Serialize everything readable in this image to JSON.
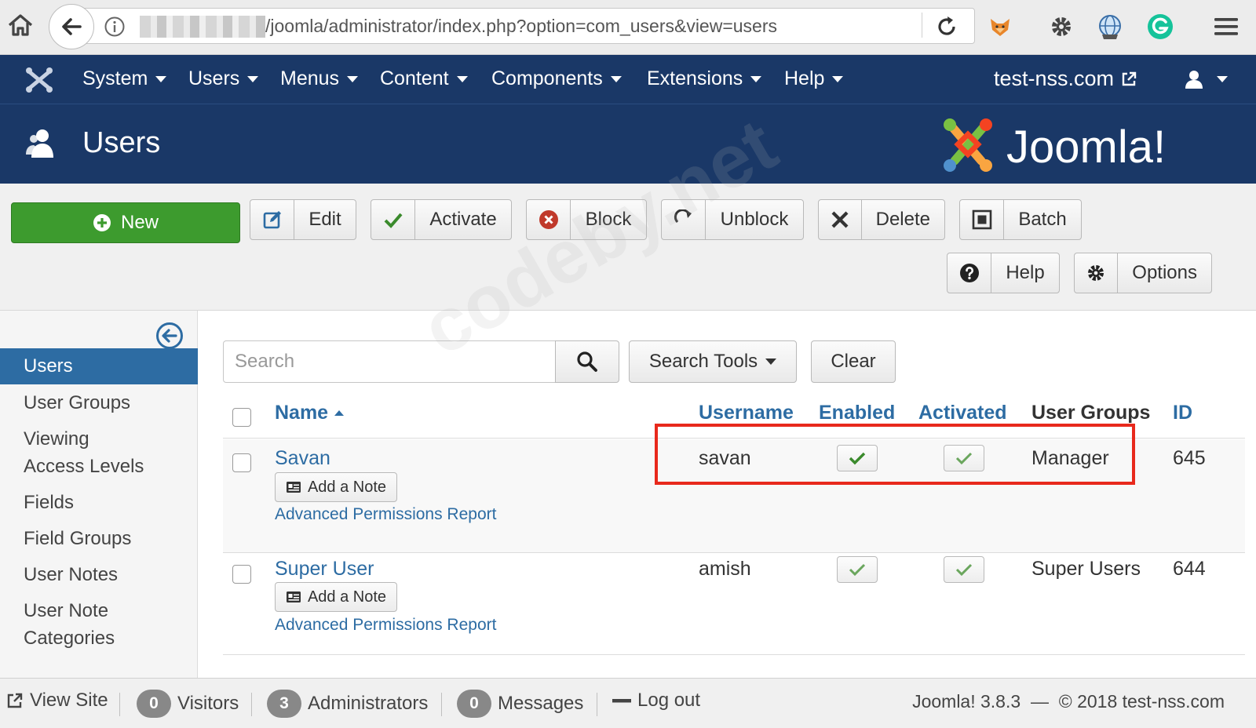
{
  "browser": {
    "url": "/joomla/administrator/index.php?option=com_users&view=users"
  },
  "navbar": {
    "items": [
      {
        "label": "System"
      },
      {
        "label": "Users"
      },
      {
        "label": "Menus"
      },
      {
        "label": "Content"
      },
      {
        "label": "Components"
      },
      {
        "label": "Extensions"
      },
      {
        "label": "Help"
      }
    ],
    "site_name": "test-nss.com"
  },
  "header": {
    "title": "Users",
    "brand": "Joomla!"
  },
  "toolbar": {
    "new": "New",
    "edit": "Edit",
    "activate": "Activate",
    "block": "Block",
    "unblock": "Unblock",
    "delete": "Delete",
    "batch": "Batch",
    "help": "Help",
    "options": "Options"
  },
  "sidebar": {
    "items": [
      {
        "label": "Users"
      },
      {
        "label": "User Groups"
      },
      {
        "label": "Viewing"
      },
      {
        "label": "Access Levels"
      },
      {
        "label": "Fields"
      },
      {
        "label": "Field Groups"
      },
      {
        "label": "User Notes"
      },
      {
        "label": "User Note"
      },
      {
        "label": "Categories"
      }
    ]
  },
  "filters": {
    "search_placeholder": "Search",
    "search_tools": "Search Tools",
    "clear": "Clear"
  },
  "table": {
    "headers": {
      "name": "Name",
      "username": "Username",
      "enabled": "Enabled",
      "activated": "Activated",
      "groups": "User Groups",
      "id": "ID"
    },
    "rows": [
      {
        "name": "Savan",
        "note": "Add a Note",
        "permissions": "Advanced Permissions Report",
        "username": "savan",
        "groups": "Manager",
        "id": "645"
      },
      {
        "name": "Super User",
        "note": "Add a Note",
        "permissions": "Advanced Permissions Report",
        "username": "amish",
        "groups": "Super Users",
        "id": "644"
      }
    ]
  },
  "footer": {
    "view_site": "View Site",
    "visitors_count": "0",
    "visitors": "Visitors",
    "admins_count": "3",
    "admins": "Administrators",
    "messages_count": "0",
    "messages": "Messages",
    "logout": "Log out",
    "version": "Joomla! 3.8.3",
    "dash": "—",
    "copyright": "© 2018 test-nss.com"
  },
  "watermark": "codeby.net",
  "colors": {
    "navbar": "#1a3867",
    "accent": "#2d6ca3",
    "new_button": "#3d9b2e",
    "highlight": "#e8291c",
    "check": "#3a8a2c"
  },
  "icons": {
    "browser": [
      "home-icon",
      "back-arrow-icon",
      "info-icon",
      "reload-icon",
      "fox-extension-icon",
      "gear-icon",
      "globe-icon",
      "grammarly-icon",
      "hamburger-menu-icon"
    ],
    "navbar": [
      "joomla-logo-icon",
      "external-link-icon",
      "user-icon"
    ],
    "toolbar": [
      "plus-circle-icon",
      "edit-icon",
      "check-icon",
      "block-circle-icon",
      "redo-icon",
      "x-icon",
      "batch-square-icon",
      "question-circle-icon",
      "gear-icon"
    ]
  }
}
